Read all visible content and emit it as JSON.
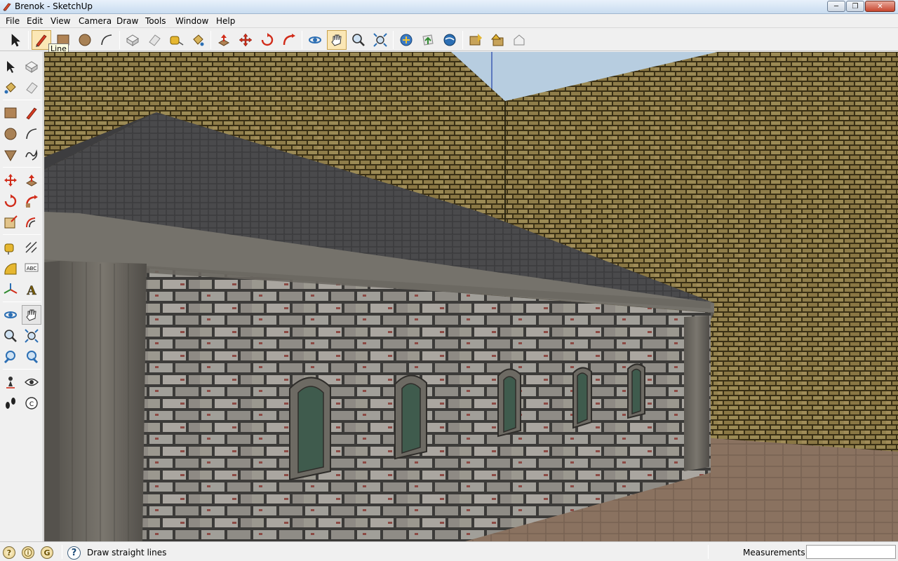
{
  "window": {
    "title": "Brenok - SketchUp",
    "minimize_glyph": "─",
    "maximize_glyph": "❐",
    "close_glyph": "✕"
  },
  "menu": {
    "items": [
      "File",
      "Edit",
      "View",
      "Camera",
      "Draw",
      "Tools",
      "Window",
      "Help"
    ]
  },
  "toolbar": {
    "tooltip": "Line",
    "icons": [
      "select-icon",
      "line-icon",
      "rectangle-icon",
      "circle-icon",
      "arc-icon",
      "make-component-icon",
      "eraser-icon",
      "tape-measure-icon",
      "paint-bucket-icon",
      "push-pull-icon",
      "move-icon",
      "rotate-icon",
      "follow-me-icon",
      "orbit-icon",
      "pan-icon",
      "zoom-icon",
      "zoom-extents-icon",
      "get-models-icon",
      "share-model-icon",
      "google-earth-icon",
      "get-current-view-icon",
      "toggle-terrain-icon",
      "place-model-icon"
    ]
  },
  "left_toolbar": {
    "icons": [
      "select-icon",
      "make-component-icon",
      "paint-bucket-icon",
      "eraser-icon",
      "rectangle-icon",
      "line-icon",
      "circle-icon",
      "arc-icon",
      "polygon-icon",
      "freehand-icon",
      "move-icon",
      "push-pull-icon",
      "rotate-icon",
      "follow-me-icon",
      "scale-icon",
      "offset-icon",
      "tape-measure-icon",
      "dimension-icon",
      "protractor-icon",
      "text-icon",
      "axes-icon",
      "3d-text-icon",
      "orbit-icon",
      "pan-icon",
      "zoom-icon",
      "zoom-window-icon",
      "previous-view-icon",
      "next-view-icon",
      "position-camera-icon",
      "look-around-icon",
      "walk-icon",
      "section-plane-icon"
    ],
    "text_tool_glyph": "ABC",
    "three_d_text_glyph": "A",
    "section_glyph": "C"
  },
  "status": {
    "icons": [
      "geo-location-icon",
      "credits-icon",
      "user-icon"
    ],
    "geo_glyph": "?",
    "credits_glyph": "ⓘ",
    "user_glyph": "G",
    "help_glyph": "?",
    "hint": "Draw straight lines",
    "measurements_label": "Measurements",
    "measurements_value": ""
  },
  "colors": {
    "sky": "#b7cde0",
    "roof": "#4a4a4c",
    "ground": "#8a7260",
    "stone_wall": "#8d8b85",
    "brick_wall": "#7a6a3a"
  }
}
